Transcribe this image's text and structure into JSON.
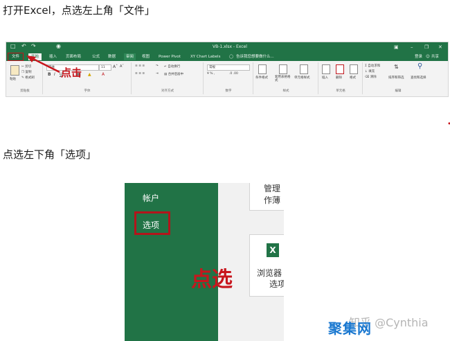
{
  "step1_text": "打开Excel，点选左上角「文件」",
  "step2_text": "点选左下角「选项」",
  "ribbon": {
    "window_title": "VB-1.xlsx - Excel",
    "tabs": [
      "文件",
      "开始",
      "插入",
      "页面布局",
      "公式",
      "数据",
      "审阅",
      "视图",
      "Power Pivot",
      "XY Chart Labels"
    ],
    "search_hint": "告诉我您想要做什么...",
    "login": "登录",
    "share": "共享",
    "clipboard": {
      "paste": "粘贴",
      "cut": "剪切",
      "copy": "复制",
      "format_painter": "格式刷",
      "label": "剪贴板"
    },
    "font": {
      "name": "宋体",
      "size": "11",
      "label": "字体"
    },
    "alignment": {
      "wrap": "自动换行",
      "merge": "合并后居中",
      "label": "对齐方式"
    },
    "number": {
      "format": "常规",
      "label": "数字"
    },
    "styles": {
      "conditional": "条件格式",
      "table": "套用表格格式",
      "cell": "单元格样式",
      "label": "样式"
    },
    "cells": {
      "insert": "插入",
      "delete": "删除",
      "format": "格式",
      "label": "单元格"
    },
    "editing": {
      "autosum": "自动求和",
      "fill": "填充",
      "clear": "清除",
      "sort": "排序和筛选",
      "find": "查找和选择",
      "label": "编辑"
    },
    "annotation": "点击"
  },
  "backstage": {
    "account": "帐户",
    "options": "选项",
    "card1_line1": "管理",
    "card1_line2": "作薄",
    "card2_line1": "浏览器",
    "card2_line2": "选项",
    "annotation": "点选"
  },
  "watermark": "知乎 @Cynthia",
  "brand": "聚集网",
  "colors": {
    "excel_green": "#217346",
    "highlight_red": "#c0161c",
    "brand_blue": "#1a78d0"
  }
}
